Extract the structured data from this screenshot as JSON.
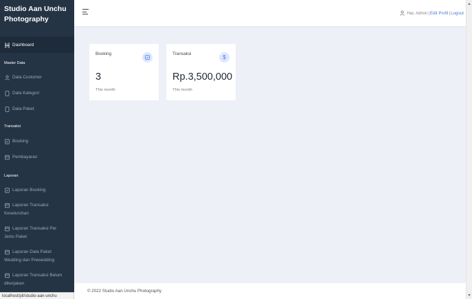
{
  "sidebar": {
    "brand_line1": "Studio Aan Unchu",
    "brand_line2": "Photography",
    "dashboard_label": "Dashboard",
    "section_master": "Master Data",
    "data_customer": "Data Customer",
    "data_kategori": "Data Kategori",
    "data_paket": "Data Paket",
    "section_transaksi": "Transaksi",
    "booking": "Booking",
    "pembayaran": "Pembayaran",
    "section_laporan": "Laporan",
    "laporan_booking": "Laporan Booking",
    "laporan_transaksi_1": "Laporan Transaksi",
    "laporan_transaksi_2": "Keseluruhan",
    "laporan_per_1": "Laporan Transaksi Per",
    "laporan_per_2": "Jenis Paket",
    "laporan_paket_1": "Laporan Data Paket",
    "laporan_paket_2": "Wedding dan Prewedding",
    "laporan_belum_1": "Laporan Transaksi Belum",
    "laporan_belum_2": "dikerjakan"
  },
  "statusbar": {
    "url": "localhost/pit/studio-aan-unchu"
  },
  "topbar": {
    "greeting": "Hai, Admin",
    "edit_profile": "Edit Profil",
    "logout": "Logout"
  },
  "cards": [
    {
      "title": "Booking",
      "value": "3",
      "sub": "This month",
      "icon": "check-square-icon"
    },
    {
      "title": "Transaksi",
      "value": "Rp.3,500,000",
      "sub": "This month",
      "icon": "dollar-icon"
    }
  ],
  "footer": {
    "text": "© 2022 Studio Aan Unchu Photography"
  },
  "colors": {
    "sidebar": "#253445",
    "accent": "#4b7bd9",
    "background": "#eef0f8"
  }
}
